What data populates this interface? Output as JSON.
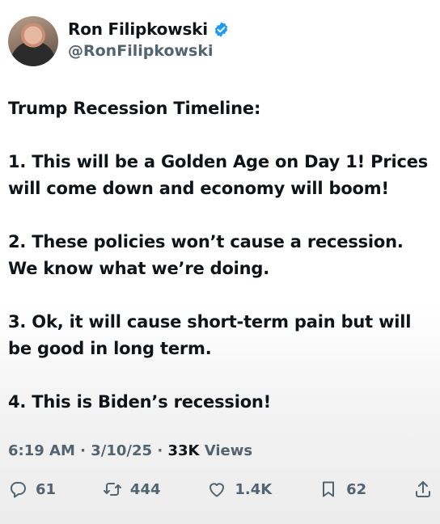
{
  "author": {
    "display_name": "Ron Filipkowski",
    "handle": "@RonFilipkowski",
    "verified_icon": "verified-badge-icon",
    "verified_color": "#1d9bf0"
  },
  "tweet": {
    "paragraphs": [
      "Trump Recession Timeline:",
      "1. This will be a Golden Age on Day 1! Prices will come down and economy will boom!",
      "2. These policies won’t cause a recession. We know what we’re doing.",
      "3. Ok, it will cause short-term pain but will be good in long term.",
      "4. This is Biden’s recession!"
    ]
  },
  "meta": {
    "time": "6:19 AM",
    "date": "3/10/25",
    "separator": "·",
    "views_count": "33K",
    "views_label": "Views"
  },
  "actions": {
    "replies": "61",
    "retweets": "444",
    "likes": "1.4K",
    "bookmarks": "62",
    "icons": [
      "reply-icon",
      "retweet-icon",
      "like-icon",
      "bookmark-icon",
      "share-icon"
    ]
  }
}
